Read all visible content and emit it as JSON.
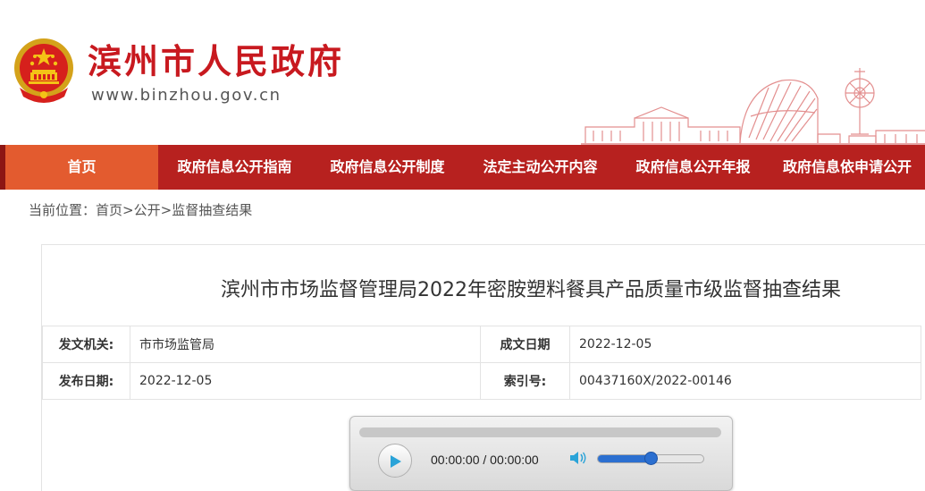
{
  "header": {
    "site_title": "滨州市人民政府",
    "site_url": "www.binzhou.gov.cn",
    "brand_color": "#c8191f"
  },
  "nav": {
    "items": [
      {
        "label": "首页",
        "active": true
      },
      {
        "label": "政府信息公开指南",
        "active": false
      },
      {
        "label": "政府信息公开制度",
        "active": false
      },
      {
        "label": "法定主动公开内容",
        "active": false
      },
      {
        "label": "政府信息公开年报",
        "active": false
      },
      {
        "label": "政府信息依申请公开",
        "active": false
      }
    ],
    "bg_color": "#b7211f",
    "active_color": "#e35b2f"
  },
  "breadcrumb": {
    "prefix": "当前位置：",
    "items": [
      "首页",
      "公开",
      "监督抽查结果"
    ],
    "separator": ">"
  },
  "article": {
    "title": "滨州市市场监督管理局2022年密胺塑料餐具产品质量市级监督抽查结果",
    "meta": {
      "issuer_label": "发文机关:",
      "issuer_value": "市市场监管局",
      "created_label": "成文日期",
      "created_value": "2022-12-05",
      "published_label": "发布日期:",
      "published_value": "2022-12-05",
      "index_label": "索引号:",
      "index_value": "00437160X/2022-00146"
    }
  },
  "player": {
    "time_display": "00:00:00 / 00:00:00",
    "volume": 0.5,
    "icons": {
      "play": "play-icon",
      "volume": "speaker-icon"
    }
  }
}
